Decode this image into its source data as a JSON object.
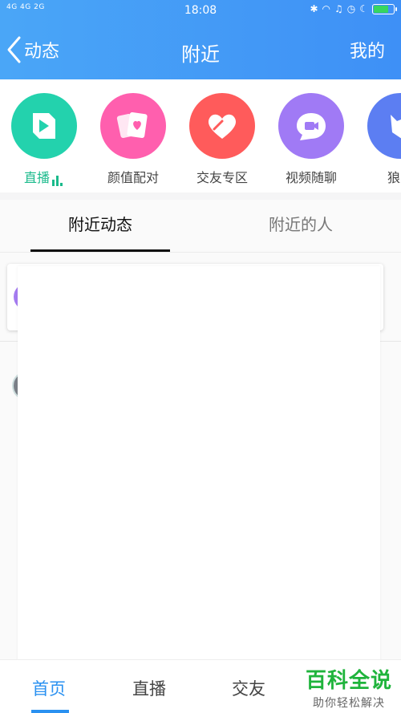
{
  "status_bar": {
    "network": "4G 4G 2G",
    "time": "18:08"
  },
  "header": {
    "back_label": "动态",
    "title": "附近",
    "mine_label": "我的"
  },
  "categories": [
    {
      "label": "直播",
      "icon": "live-icon",
      "color": "#23d2ad",
      "active": true
    },
    {
      "label": "颜值配对",
      "icon": "cards-heart-icon",
      "color": "#ff5fae"
    },
    {
      "label": "交友专区",
      "icon": "heart-icon",
      "color": "#ff5b5b"
    },
    {
      "label": "视频随聊",
      "icon": "video-chat-icon",
      "color": "#a07af5"
    },
    {
      "label": "狼人",
      "icon": "wolf-icon",
      "color": "#5c7ef2"
    }
  ],
  "tabs": [
    {
      "label": "附近动态",
      "active": true
    },
    {
      "label": "附近的人",
      "active": false
    }
  ],
  "bottom_nav": [
    {
      "label": "首页",
      "active": true
    },
    {
      "label": "直播",
      "active": false
    },
    {
      "label": "交友",
      "active": false
    }
  ],
  "watermark": {
    "title": "百科全说",
    "subtitle": "助你轻松解决"
  },
  "colors": {
    "header_blue": "#3e90f6",
    "accent_green": "#1aba8b",
    "nav_blue": "#2a91f1"
  }
}
